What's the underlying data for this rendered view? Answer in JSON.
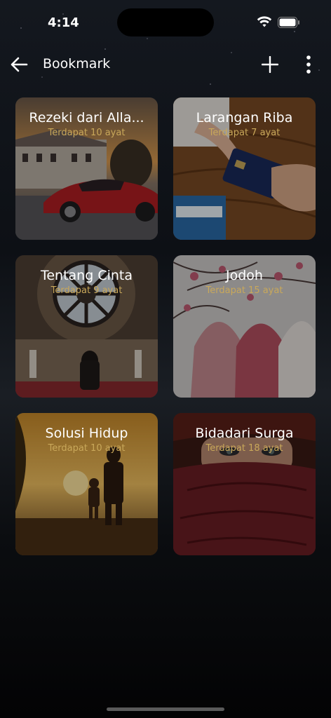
{
  "status": {
    "time": "4:14"
  },
  "appbar": {
    "title": "Bookmark"
  },
  "cards": [
    {
      "title": "Rezeki dari Alla...",
      "subtitle": "Terdapat 10 ayat"
    },
    {
      "title": "Larangan Riba",
      "subtitle": "Terdapat 7 ayat"
    },
    {
      "title": "Tentang Cinta",
      "subtitle": "Terdapat 9 ayat"
    },
    {
      "title": "Jodoh",
      "subtitle": "Terdapat 15 ayat"
    },
    {
      "title": "Solusi Hidup",
      "subtitle": "Terdapat 10 ayat"
    },
    {
      "title": "Bidadari Surga",
      "subtitle": "Terdapat 18 ayat"
    }
  ],
  "icons": {
    "back": "arrow-left-icon",
    "add": "plus-icon",
    "more": "more-vertical-icon",
    "wifi": "wifi-icon",
    "battery": "battery-icon"
  },
  "colors": {
    "subtitle": "#c9a85a",
    "background": "#050608"
  }
}
